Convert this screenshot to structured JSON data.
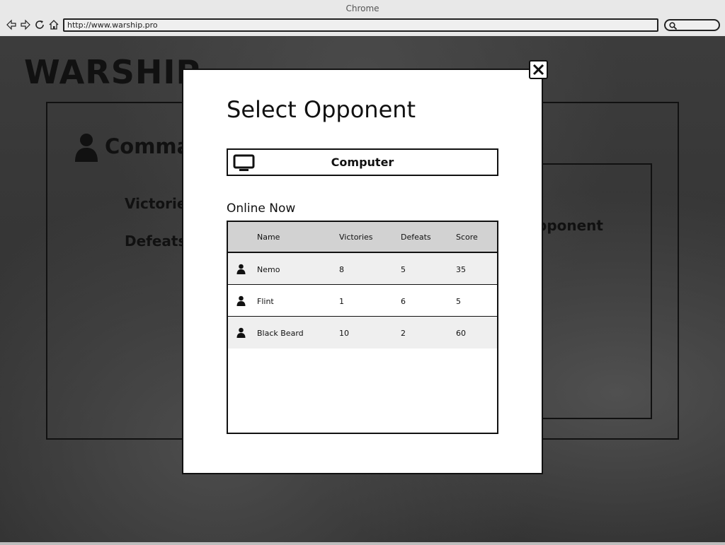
{
  "browser": {
    "window_title": "Chrome",
    "url": "http://www.warship.pro"
  },
  "app": {
    "title": "WARSHIP",
    "panel_heading": "Comma",
    "victories_label": "Victorie",
    "defeats_label": "Defeats",
    "opponent_label": "pponent"
  },
  "modal": {
    "title": "Select Opponent",
    "computer_button_label": "Computer",
    "online_heading": "Online Now",
    "table": {
      "columns": [
        "Name",
        "Victories",
        "Defeats",
        "Score"
      ],
      "rows": [
        {
          "name": "Nemo",
          "victories": "8",
          "defeats": "5",
          "score": "35"
        },
        {
          "name": "Flint",
          "victories": "1",
          "defeats": "6",
          "score": "5"
        },
        {
          "name": "Black Beard",
          "victories": "10",
          "defeats": "2",
          "score": "60"
        }
      ]
    }
  },
  "icons": {
    "back": "back-arrow-icon",
    "forward": "forward-arrow-icon",
    "reload": "reload-icon",
    "home": "home-icon",
    "search": "search-icon",
    "close": "close-icon",
    "computer": "monitor-icon",
    "user": "user-icon"
  },
  "colors": {
    "table_header": "#d2d2d2",
    "row_alt": "#efefef",
    "border": "#111111"
  }
}
